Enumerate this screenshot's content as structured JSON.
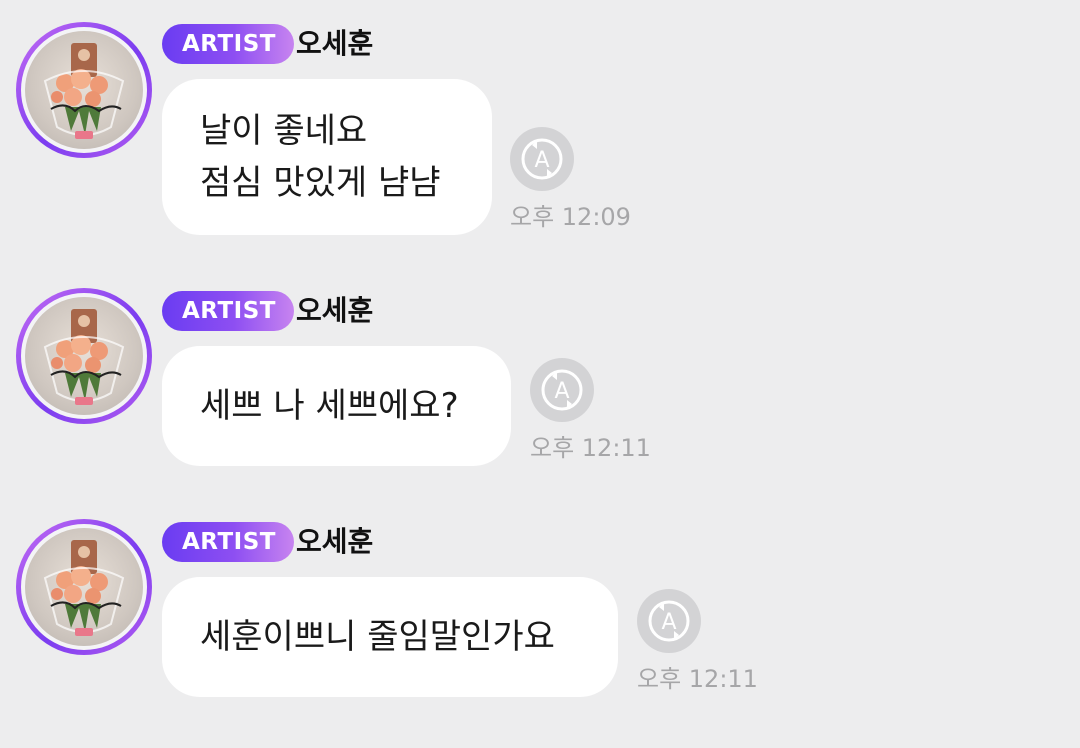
{
  "messages": [
    {
      "badge": "ARTIST",
      "sender": "오세훈",
      "lines": [
        "날이 좋네요",
        "점심 맛있게 냠냠"
      ],
      "time": "오후 12:09"
    },
    {
      "badge": "ARTIST",
      "sender": "오세훈",
      "lines": [
        "세쁘 나 세쁘에요?"
      ],
      "time": "오후 12:11"
    },
    {
      "badge": "ARTIST",
      "sender": "오세훈",
      "lines": [
        "세훈이쁘니 줄임말인가요"
      ],
      "time": "오후 12:11"
    }
  ],
  "icons": {
    "translate": "translate-icon",
    "avatar": "profile-photo-bouquet"
  },
  "colors": {
    "background": "#ededee",
    "badge_start": "#6a3cf2",
    "badge_end": "#c784f0",
    "avatar_ring": "#8e4ff2",
    "bubble": "#ffffff",
    "time": "#a6a6a8",
    "translate_button": "#d3d3d5"
  }
}
